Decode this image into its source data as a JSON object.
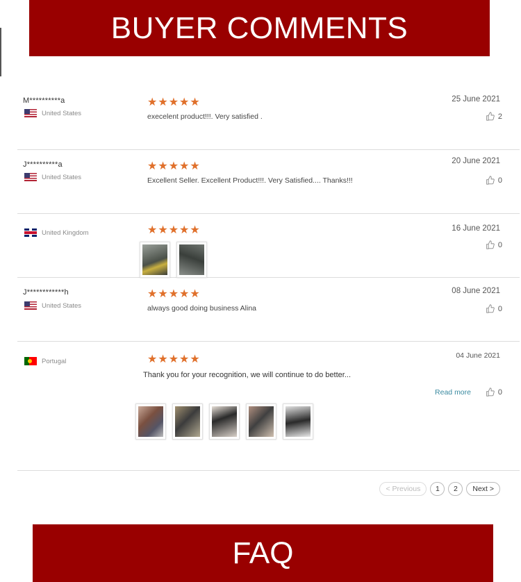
{
  "banners": {
    "top": "BUYER COMMENTS",
    "bottom": "FAQ"
  },
  "reviews": [
    {
      "user": "M**********a",
      "country": "United States",
      "flag": "us-flag-icon",
      "rating": 5,
      "text": "execelent product!!!.  Very satisfied .",
      "date": "25  June 2021",
      "likes": "2"
    },
    {
      "user": "J**********a",
      "country": "United States",
      "flag": "us-flag-icon",
      "rating": 5,
      "text": "Excellent Seller. Excellent Product!!!.  Very Satisfied.... Thanks!!!",
      "date": "20  June 2021",
      "likes": "0"
    },
    {
      "user": "",
      "country": "United Kingdom",
      "flag": "uk-flag-icon",
      "rating": 5,
      "text": "",
      "date": "16  June 2021",
      "likes": "0"
    },
    {
      "user": "J************h",
      "country": "United States",
      "flag": "us-flag-icon",
      "rating": 5,
      "text": "always good doing business Alina",
      "date": "08  June 2021",
      "likes": "0"
    },
    {
      "user": "",
      "country": "Portugal",
      "flag": "portugal-flag-icon",
      "rating": 5,
      "text": "Thank you for your recognition, we will continue to do better...",
      "date": "04 June 2021",
      "likes": "0",
      "read_more": "Read more"
    }
  ],
  "stars_glyph": "★★★★★",
  "pagination": {
    "previous": "< Previous",
    "pages": [
      "1",
      "2"
    ],
    "next": "Next >"
  },
  "colors": {
    "banner": "#990000",
    "star": "#e0702b",
    "link": "#3a8aa0"
  }
}
